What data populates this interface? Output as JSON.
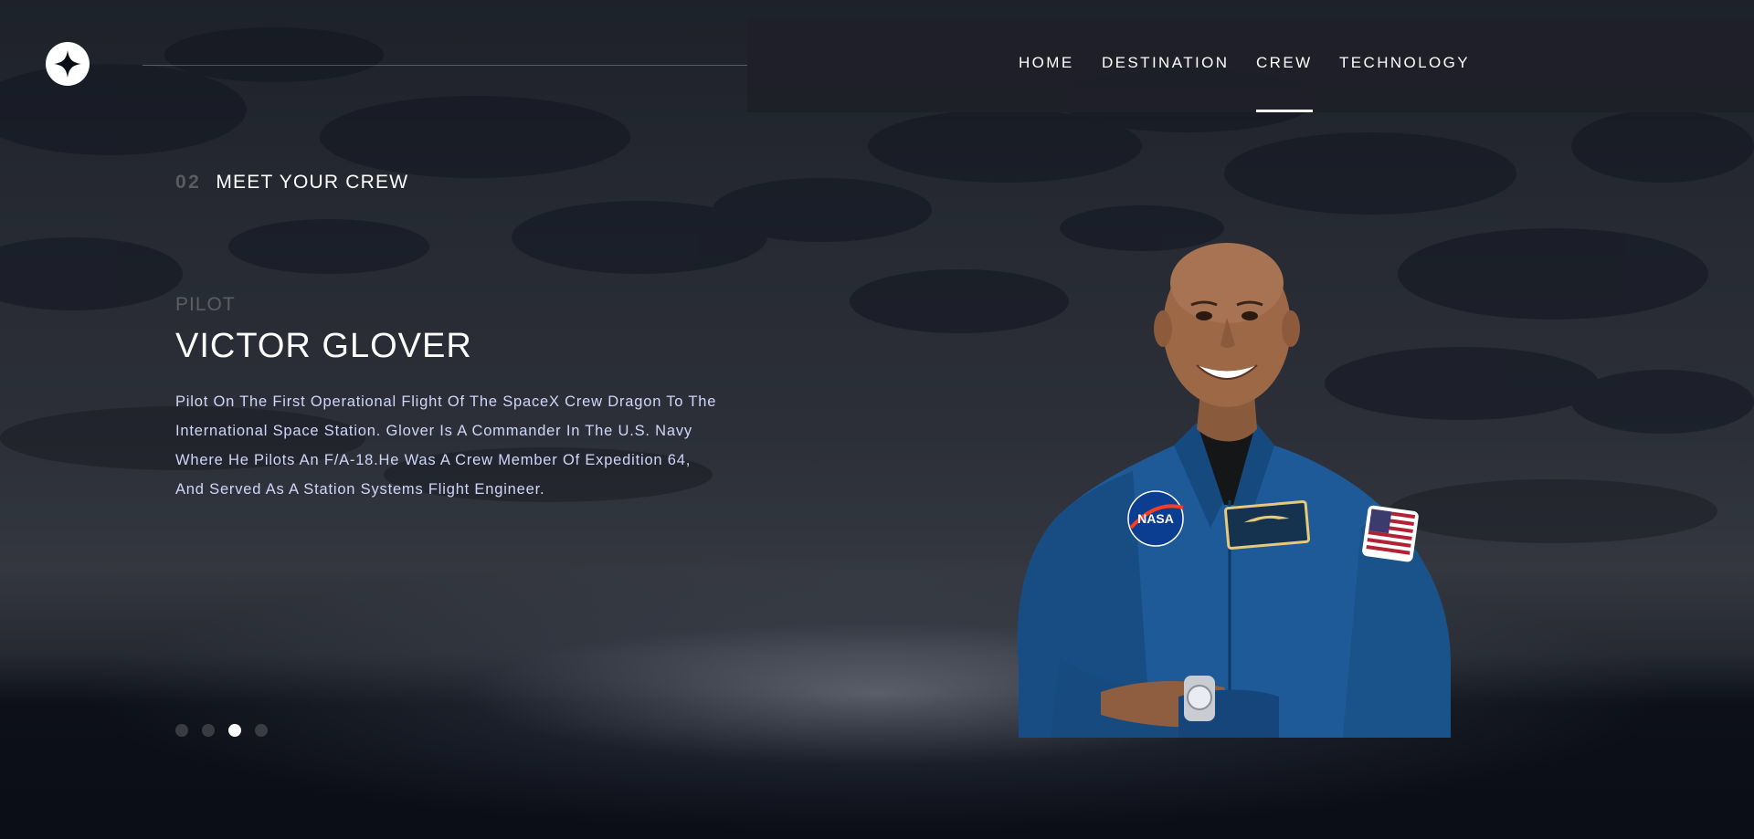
{
  "nav": {
    "items": [
      {
        "label": "HOME",
        "active": false
      },
      {
        "label": "DESTINATION",
        "active": false
      },
      {
        "label": "CREW",
        "active": true
      },
      {
        "label": "TECHNOLOGY",
        "active": false
      }
    ]
  },
  "header": {
    "section_number": "02",
    "section_title": "MEET YOUR CREW"
  },
  "crew": {
    "role": "PILOT",
    "name": "VICTOR GLOVER",
    "bio": "Pilot On The First Operational Flight Of The SpaceX Crew Dragon To The International Space Station. Glover Is A Commander In The U.S. Navy Where He Pilots An F/A-18.He Was A Crew Member Of Expedition 64, And Served As A Station Systems Flight Engineer.",
    "active_index": 2,
    "count": 4
  },
  "colors": {
    "background": "#0b0d17",
    "accent_text": "#d0d6f9",
    "muted": "#5c5e66"
  },
  "icons": {
    "logo": "four-point-star-icon",
    "portrait": "astronaut-portrait"
  }
}
